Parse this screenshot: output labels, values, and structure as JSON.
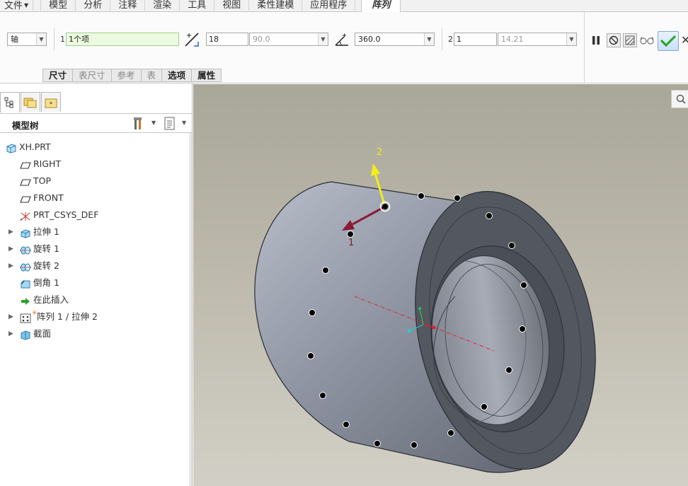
{
  "menu": {
    "items": [
      "文件",
      "模型",
      "分析",
      "注释",
      "渲染",
      "工具",
      "视图",
      "柔性建模",
      "应用程序"
    ],
    "active_tab": "阵列"
  },
  "dashboard": {
    "pattern_type": "轴",
    "dir1_index": "1",
    "dir1_members": "1个项",
    "angle_increment": "18",
    "angle_increment_suggest": "90.0",
    "angle_total": "360.0",
    "dir2_index": "2",
    "dir2_members": "1",
    "dir2_spacing": "14.21",
    "subtabs": [
      {
        "label": "尺寸",
        "enabled": true
      },
      {
        "label": "表尺寸",
        "enabled": false
      },
      {
        "label": "参考",
        "enabled": false
      },
      {
        "label": "表",
        "enabled": false
      },
      {
        "label": "选项",
        "enabled": true
      },
      {
        "label": "属性",
        "enabled": true
      }
    ]
  },
  "navigator": {
    "title": "模型树",
    "tree": [
      {
        "label": "XH.PRT",
        "icon": "part-icon",
        "expandable": false,
        "indent": 0
      },
      {
        "label": "RIGHT",
        "icon": "datum-plane-icon",
        "expandable": false,
        "indent": 1
      },
      {
        "label": "TOP",
        "icon": "datum-plane-icon",
        "expandable": false,
        "indent": 1
      },
      {
        "label": "FRONT",
        "icon": "datum-plane-icon",
        "expandable": false,
        "indent": 1
      },
      {
        "label": "PRT_CSYS_DEF",
        "icon": "csys-icon",
        "expandable": false,
        "indent": 1
      },
      {
        "label": "拉伸 1",
        "icon": "extrude-icon",
        "expandable": true,
        "indent": 1
      },
      {
        "label": "旋转 1",
        "icon": "revolve-icon",
        "expandable": true,
        "indent": 1
      },
      {
        "label": "旋转 2",
        "icon": "revolve-icon",
        "expandable": true,
        "indent": 1
      },
      {
        "label": "倒角 1",
        "icon": "chamfer-icon",
        "expandable": false,
        "indent": 1
      },
      {
        "label": "在此插入",
        "icon": "insert-here-icon",
        "expandable": false,
        "indent": 1
      },
      {
        "label": "阵列 1 / 拉伸 2",
        "icon": "pattern-icon",
        "expandable": true,
        "indent": 1
      },
      {
        "label": "截面",
        "icon": "section-icon",
        "expandable": true,
        "indent": 1
      }
    ]
  },
  "graphics": {
    "direction1_label": "1",
    "direction2_label": "2",
    "pattern_point_count": 20
  },
  "colors": {
    "accent_green": "#2fa52f",
    "dir1_arrow": "#8b1a35",
    "dir2_arrow": "#f2ee1a"
  }
}
